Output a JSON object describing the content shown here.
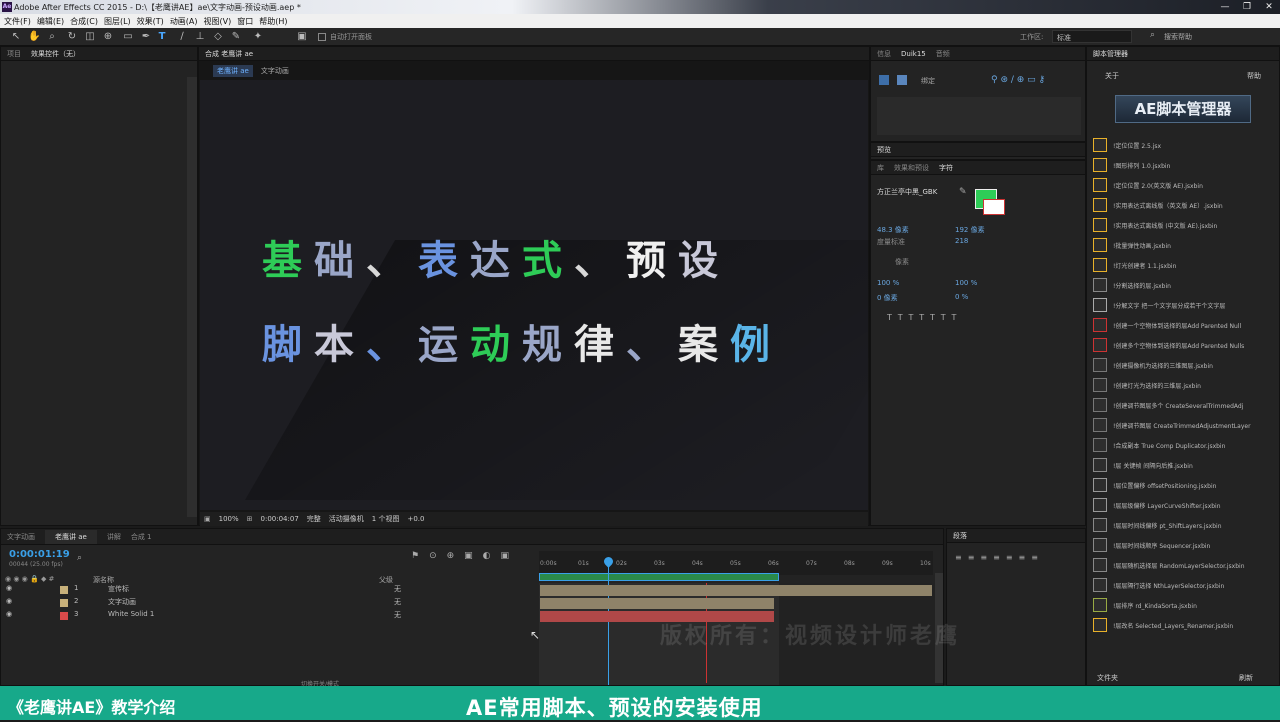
{
  "window": {
    "title": "Adobe After Effects CC 2015 - D:\\【老鹰讲AE】ae\\文字动画-预设动画.aep *"
  },
  "menu": [
    "文件(F)",
    "编辑(E)",
    "合成(C)",
    "图层(L)",
    "效果(T)",
    "动画(A)",
    "视图(V)",
    "窗口",
    "帮助(H)"
  ],
  "toolbar": {
    "auto_open": "自动打开面板",
    "workspace_label": "工作区:",
    "workspace_value": "标准",
    "search_placeholder": "搜索帮助"
  },
  "left_panel": {
    "tabs": [
      "项目",
      "效果控件（无）"
    ]
  },
  "comp_panel": {
    "header": "合成 老鹰讲 ae",
    "breadcrumbs": [
      "老鹰讲 ae",
      "文字动画"
    ],
    "line1": [
      {
        "t": "基",
        "c": "#2ecc57"
      },
      {
        "t": "础",
        "c": "#9aa6c8"
      },
      {
        "t": "、",
        "c": "#d8d8d8"
      },
      {
        "t": "表",
        "c": "#6a93e0"
      },
      {
        "t": "达",
        "c": "#9aa6c8"
      },
      {
        "t": "式",
        "c": "#2ecc57"
      },
      {
        "t": "、",
        "c": "#d8d8d8"
      },
      {
        "t": "预",
        "c": "#f0f0f0"
      },
      {
        "t": "设",
        "c": "#c8c8d8"
      }
    ],
    "line2": [
      {
        "t": "脚",
        "c": "#6a93e0"
      },
      {
        "t": "本",
        "c": "#c8c8d8"
      },
      {
        "t": "、",
        "c": "#6a93e0"
      },
      {
        "t": "运",
        "c": "#9aa6c8"
      },
      {
        "t": "动",
        "c": "#2ecc57"
      },
      {
        "t": "规",
        "c": "#9aa6c8"
      },
      {
        "t": "律",
        "c": "#e8e8e8"
      },
      {
        "t": "、",
        "c": "#9aa6c8"
      },
      {
        "t": "案",
        "c": "#e8e8e8"
      },
      {
        "t": "例",
        "c": "#5ab4e8"
      }
    ],
    "footer": {
      "zoom": "100%",
      "time": "0:00:04:07",
      "quality": "完整",
      "camera": "活动摄像机",
      "views": "1 个视图",
      "offset": "+0.0"
    }
  },
  "right_top": {
    "tabs": [
      "信息",
      "Duik15",
      "音频"
    ],
    "sub": "绑定"
  },
  "preview_tab": "预览",
  "char_panel": {
    "tabs": [
      "库",
      "效果和预设",
      "字符"
    ],
    "font": "方正兰亭中黑_GBK",
    "size": "48.3 像素",
    "leading": "192 像素",
    "tracking": "218",
    "metric": "度量标准",
    "unit": "像素",
    "scale_v": "100 %",
    "scale_h": "100 %",
    "baseline": "0 像素",
    "tsume": "0 %"
  },
  "paragraph": {
    "title": "段落"
  },
  "scripts": {
    "title": "脚本管理器",
    "about": "关于",
    "help": "帮助",
    "logo": "AE脚本管理器",
    "items": [
      "!定位位置 2.5.jsx",
      "!图形排列 1.0.jsxbin",
      "!定位位置 2.0(英文版 AE).jsxbin",
      "!实用表达式离线版（英文版 AE）.jsxbin",
      "!实用表达式离线版 (中文版 AE).jsxbin",
      "!批量弹性动画.jsxbin",
      "!灯光创建者 1.1.jsxbin",
      "!分割选择的层.jsxbin",
      "!分解文字 把一个文字层分成若干个文字层",
      "!创建一个空物体到选择的层Add Parented Null",
      "!创建多个空物体到选择的层Add Parented Nulls",
      "!创建摄像机为选择的三维图层.jsxbin",
      "!创建灯光为选择的三维层.jsxbin",
      "!创建调节图层多个 CreateSeveralTrimmedAdj",
      "!创建调节图层 CreateTrimmedAdjustmentLayer",
      "!合成副本 True Comp Duplicator.jsxbin",
      "!层 关键帧 间隔向后推.jsxbin",
      "!层位置偏移 offsetPositioning.jsxbin",
      "!层层级偏移 LayerCurveShifter.jsxbin",
      "!层层时间线偏移 pt_ShiftLayers.jsxbin",
      "!层层时间线顺序 Sequencer.jsxbin",
      "!层层随机选择层 RandomLayerSelector.jsxbin",
      "!层层隔行选择 NthLayerSelector.jsxbin",
      "!层排序 rd_KindaSorta.jsxbin",
      "!层改名 Selected_Layers_Renamer.jsxbin"
    ],
    "footer_left": "文件夹",
    "footer_right": "刷新"
  },
  "timeline": {
    "tabs": [
      "文字动画",
      "老鹰讲 ae",
      "讲解",
      "合成 1"
    ],
    "timecode": "0:00:01:19",
    "fps": "00044 (25.00 fps)",
    "col_name": "源名称",
    "col_parent": "父级",
    "ruler": [
      "0:00s",
      "01s",
      "02s",
      "03s",
      "04s",
      "05s",
      "06s",
      "07s",
      "08s",
      "09s",
      "10s"
    ],
    "layers": [
      {
        "num": "1",
        "name": "宣传标",
        "color": "#c7b07a",
        "parent": "无"
      },
      {
        "num": "2",
        "name": "文字动画",
        "color": "#c7b07a",
        "parent": "无"
      },
      {
        "num": "3",
        "name": "White Solid 1",
        "color": "#d94a4a",
        "parent": "无"
      }
    ],
    "footer": "切换开关/模式"
  },
  "watermark": "版权所有：视频设计师老鹰",
  "banner": {
    "left": "《老鹰讲AE》教学介绍",
    "center": "AE常用脚本、预设的安装使用"
  },
  "colors": {
    "accent": "#17a98a",
    "green": "#2ecc57",
    "cti": "#3aa0e8"
  }
}
